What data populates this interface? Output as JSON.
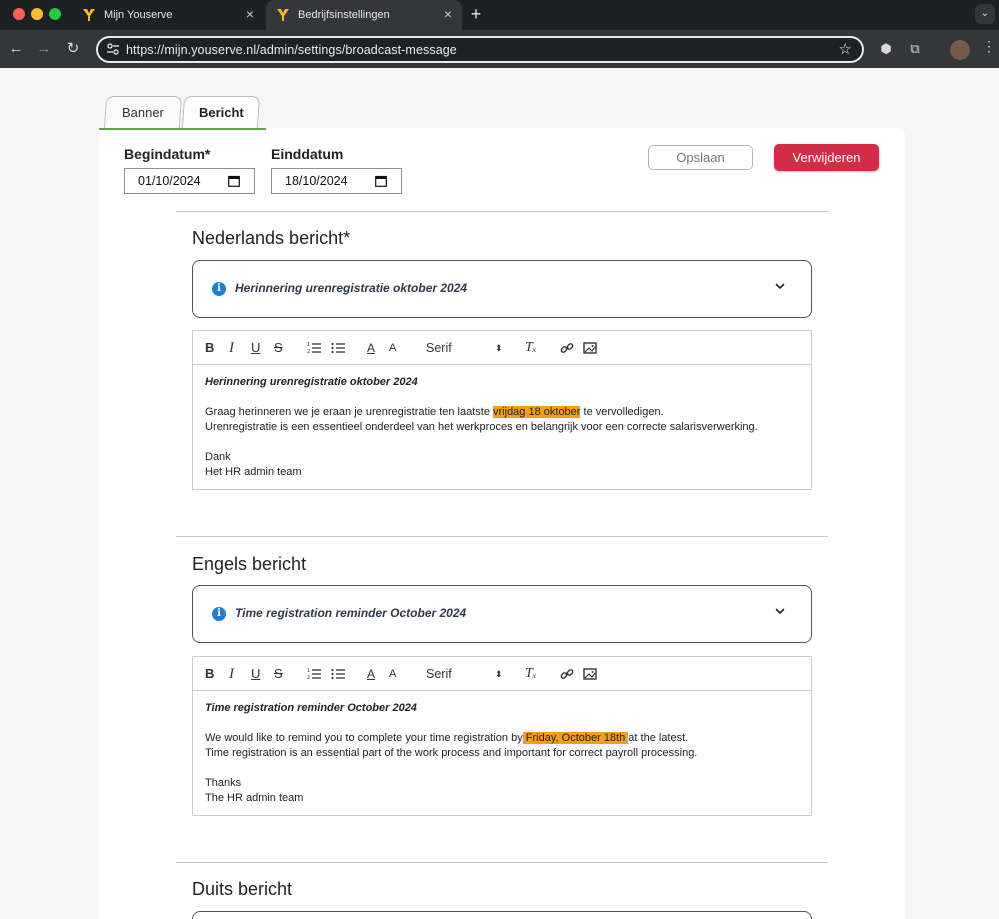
{
  "browser": {
    "tabs": [
      {
        "title": "Mijn Youserve",
        "active": false
      },
      {
        "title": "Bedrijfsinstellingen",
        "active": true
      }
    ],
    "new_tab_symbol": "+",
    "url": "https://mijn.youserve.nl/admin/settings/broadcast-message",
    "accent_color": "#f5b82e"
  },
  "page_tabs": {
    "banner": "Banner",
    "bericht": "Bericht"
  },
  "dates": {
    "start_label": "Begindatum*",
    "start_value": "01/10/2024",
    "end_label": "Einddatum",
    "end_value": "18/10/2024"
  },
  "actions": {
    "save_label": "Opslaan",
    "delete_label": "Verwijderen",
    "delete_color": "#d22d47"
  },
  "toolbar": {
    "bold": "B",
    "italic": "I",
    "underline": "U",
    "strike": "S",
    "color": "A",
    "background": "A",
    "font": "Serif",
    "font_arrow": "⬍",
    "clean": "Tₓ"
  },
  "sections": {
    "nl": {
      "title": "Nederlands bericht*",
      "accordion_title": "Herinnering urenregistratie oktober 2024",
      "body_title": "Herinnering urenregistratie oktober 2024",
      "line1_before": "Graag herinneren we je eraan je urenregistratie ten laatste ",
      "line1_highlight": "vrijdag 18 oktober",
      "line1_after": " te vervolledigen.",
      "line2": "Urenregistratie is een essentieel onderdeel van het werkproces en belangrijk voor een correcte salarisverwerking.",
      "sign1": "Dank",
      "sign2": "Het HR admin team"
    },
    "en": {
      "title": "Engels bericht",
      "accordion_title": "Time registration reminder October 2024",
      "body_title": "Time registration reminder October 2024",
      "line1_before": "We would like to remind you to complete your time registration by",
      "line1_highlight": " Friday, October 18th ",
      "line1_after": "at the latest.",
      "line2": "Time registration is an essential part of the work process and important for correct payroll processing.",
      "sign1": "Thanks",
      "sign2": "The HR admin team"
    },
    "de": {
      "title": "Duits bericht"
    }
  },
  "highlight_color": "#f59e1b"
}
